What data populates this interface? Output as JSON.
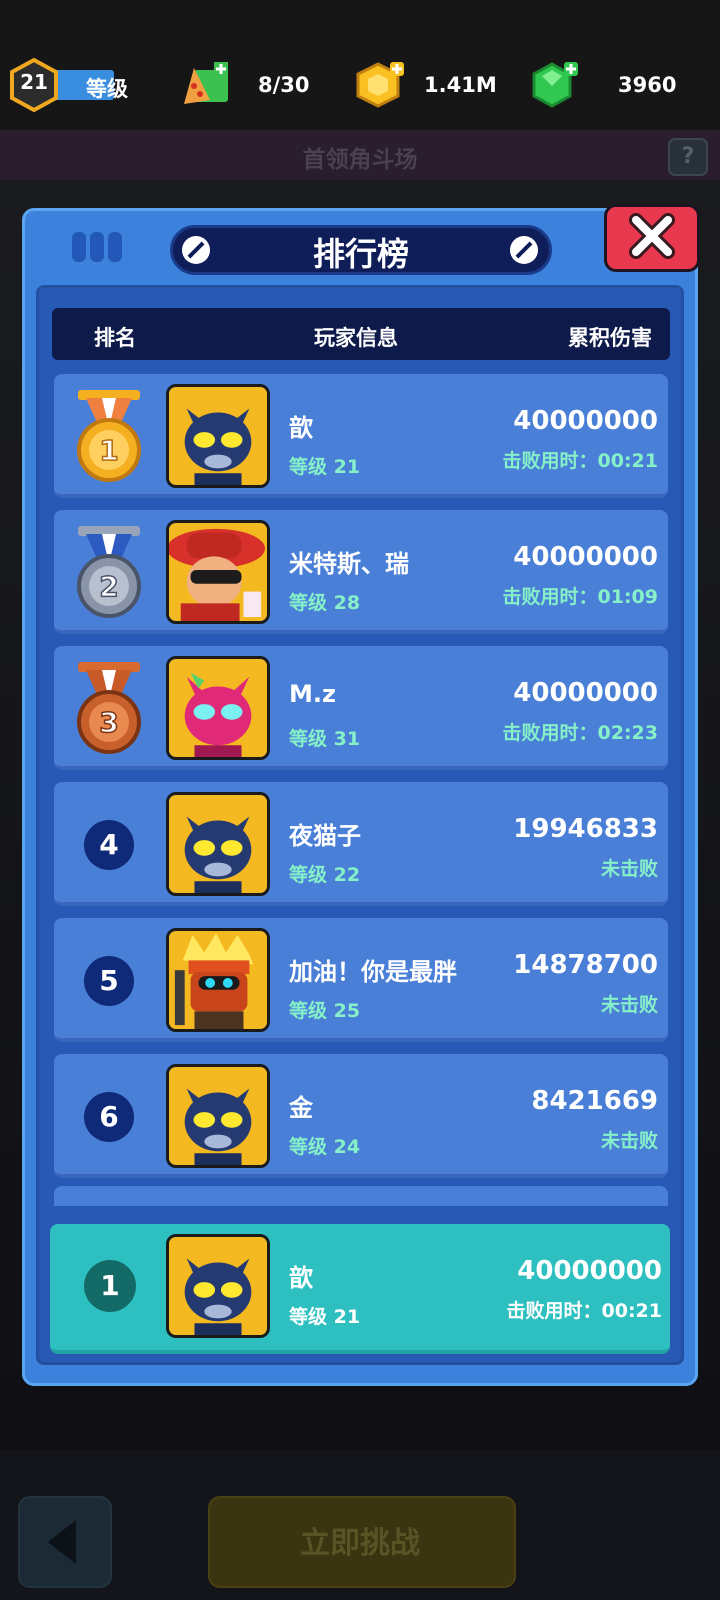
{
  "topbar": {
    "level": "21",
    "level_label": "等级",
    "stamina": "8/30",
    "gold": "1.41M",
    "gems": "3960"
  },
  "background": {
    "subtitle": "首领角斗场",
    "help": "?",
    "challenge_button": "立即挑战"
  },
  "leaderboard": {
    "title": "排行榜",
    "headers": {
      "rank": "排名",
      "player": "玩家信息",
      "damage": "累积伤害"
    },
    "rows": [
      {
        "rank": "1",
        "name": "歆",
        "level": "等级 21",
        "damage": "40000000",
        "status": "击败用时：00:21",
        "medal": "gold",
        "avatar": "blue-cat"
      },
      {
        "rank": "2",
        "name": "米特斯、瑞",
        "level": "等级 28",
        "damage": "40000000",
        "status": "击败用时：01:09",
        "medal": "silver",
        "avatar": "red-hat"
      },
      {
        "rank": "3",
        "name": "M.z",
        "level": "等级 31",
        "damage": "40000000",
        "status": "击败用时：02:23",
        "medal": "bronze",
        "avatar": "pink-cat"
      },
      {
        "rank": "4",
        "name": "夜猫子",
        "level": "等级 22",
        "damage": "19946833",
        "status": "未击败",
        "avatar": "blue-cat"
      },
      {
        "rank": "5",
        "name": "加油！你是最胖",
        "level": "等级 25",
        "damage": "14878700",
        "status": "未击败",
        "avatar": "robot-ninja"
      },
      {
        "rank": "6",
        "name": "金",
        "level": "等级 24",
        "damage": "8421669",
        "status": "未击败",
        "avatar": "blue-cat"
      }
    ],
    "me": {
      "rank": "1",
      "name": "歆",
      "level": "等级 21",
      "damage": "40000000",
      "status": "击败用时：00:21",
      "avatar": "blue-cat"
    }
  },
  "colors": {
    "panel": "#3c82dc",
    "row": "#4a7fd8",
    "highlight_row": "#2ec0c0",
    "accent_text": "#86f0c8",
    "close_button": "#e8384e"
  }
}
